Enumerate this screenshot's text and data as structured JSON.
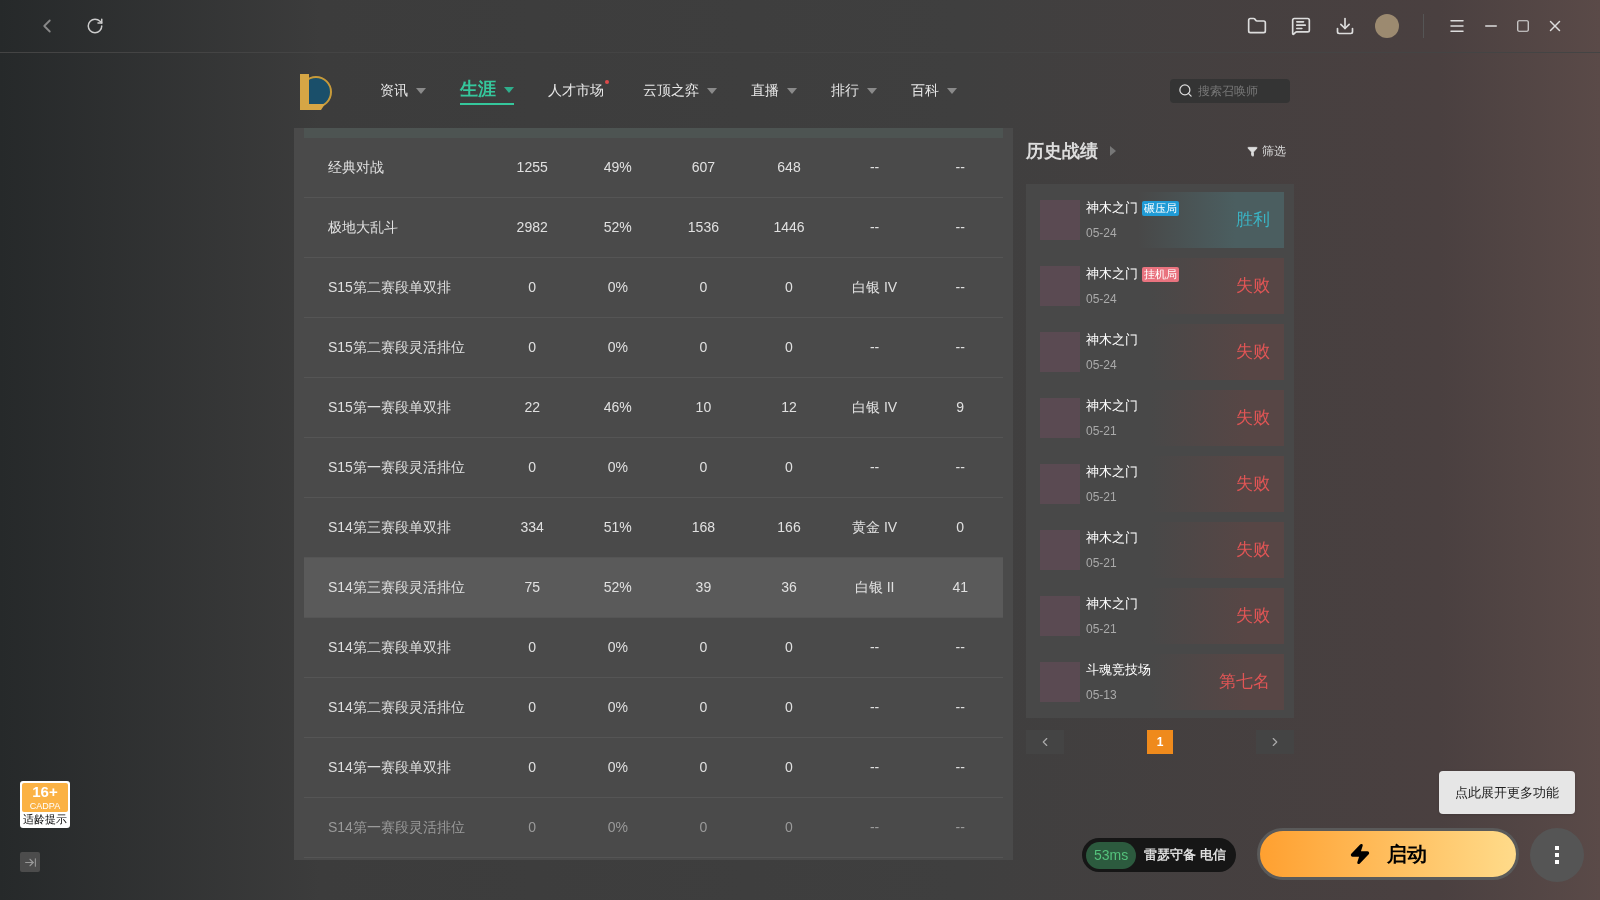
{
  "nav": [
    {
      "label": "资讯",
      "selected": false,
      "dropdown": true,
      "dot": false
    },
    {
      "label": "生涯",
      "selected": true,
      "dropdown": true,
      "dot": false
    },
    {
      "label": "人才市场",
      "selected": false,
      "dropdown": false,
      "dot": true
    },
    {
      "label": "云顶之弈",
      "selected": false,
      "dropdown": true,
      "dot": false
    },
    {
      "label": "直播",
      "selected": false,
      "dropdown": true,
      "dot": false
    },
    {
      "label": "排行",
      "selected": false,
      "dropdown": true,
      "dot": false
    },
    {
      "label": "百科",
      "selected": false,
      "dropdown": true,
      "dot": false
    }
  ],
  "search": {
    "placeholder": "搜索召唤师"
  },
  "table": {
    "rows": [
      {
        "cells": [
          "经典对战",
          "1255",
          "49%",
          "607",
          "648",
          "--",
          "--"
        ],
        "selected": false,
        "faded": false
      },
      {
        "cells": [
          "极地大乱斗",
          "2982",
          "52%",
          "1536",
          "1446",
          "--",
          "--"
        ],
        "selected": false,
        "faded": false
      },
      {
        "cells": [
          "S15第二赛段单双排",
          "0",
          "0%",
          "0",
          "0",
          "白银 IV",
          "--"
        ],
        "selected": false,
        "faded": false
      },
      {
        "cells": [
          "S15第二赛段灵活排位",
          "0",
          "0%",
          "0",
          "0",
          "--",
          "--"
        ],
        "selected": false,
        "faded": false
      },
      {
        "cells": [
          "S15第一赛段单双排",
          "22",
          "46%",
          "10",
          "12",
          "白银 IV",
          "9"
        ],
        "selected": false,
        "faded": false
      },
      {
        "cells": [
          "S15第一赛段灵活排位",
          "0",
          "0%",
          "0",
          "0",
          "--",
          "--"
        ],
        "selected": false,
        "faded": false
      },
      {
        "cells": [
          "S14第三赛段单双排",
          "334",
          "51%",
          "168",
          "166",
          "黄金 IV",
          "0"
        ],
        "selected": false,
        "faded": false
      },
      {
        "cells": [
          "S14第三赛段灵活排位",
          "75",
          "52%",
          "39",
          "36",
          "白银 II",
          "41"
        ],
        "selected": true,
        "faded": false
      },
      {
        "cells": [
          "S14第二赛段单双排",
          "0",
          "0%",
          "0",
          "0",
          "--",
          "--"
        ],
        "selected": false,
        "faded": false
      },
      {
        "cells": [
          "S14第二赛段灵活排位",
          "0",
          "0%",
          "0",
          "0",
          "--",
          "--"
        ],
        "selected": false,
        "faded": false
      },
      {
        "cells": [
          "S14第一赛段单双排",
          "0",
          "0%",
          "0",
          "0",
          "--",
          "--"
        ],
        "selected": false,
        "faded": false
      },
      {
        "cells": [
          "S14第一赛段灵活排位",
          "0",
          "0%",
          "0",
          "0",
          "--",
          "--"
        ],
        "selected": false,
        "faded": true
      }
    ]
  },
  "history": {
    "title": "历史战绩",
    "filter": "筛选",
    "matches": [
      {
        "mode": "神木之门",
        "tag": "碾压局",
        "color": "#1f9bd6",
        "date": "05-24",
        "result": "胜利",
        "kind": "win"
      },
      {
        "mode": "神木之门",
        "tag": "挂机局",
        "color": "#e9737f",
        "date": "05-24",
        "result": "失败",
        "kind": "loss"
      },
      {
        "mode": "神木之门",
        "date": "05-24",
        "result": "失败",
        "kind": "loss"
      },
      {
        "mode": "神木之门",
        "date": "05-21",
        "result": "失败",
        "kind": "loss"
      },
      {
        "mode": "神木之门",
        "date": "05-21",
        "result": "失败",
        "kind": "loss"
      },
      {
        "mode": "神木之门",
        "date": "05-21",
        "result": "失败",
        "kind": "loss"
      },
      {
        "mode": "神木之门",
        "date": "05-21",
        "result": "失败",
        "kind": "loss"
      },
      {
        "mode": "斗魂竞技场",
        "date": "05-13",
        "result": "第七名",
        "kind": "loss"
      }
    ],
    "pages": [
      {
        "label": "1",
        "selected": true
      }
    ]
  },
  "age_badge": {
    "rating": "16+",
    "org": "CADPA",
    "caption": "适龄提示"
  },
  "tooltip": "点此展开更多功能",
  "server": {
    "ping": "53ms",
    "name": "雷瑟守备 电信"
  },
  "launch": "启动"
}
